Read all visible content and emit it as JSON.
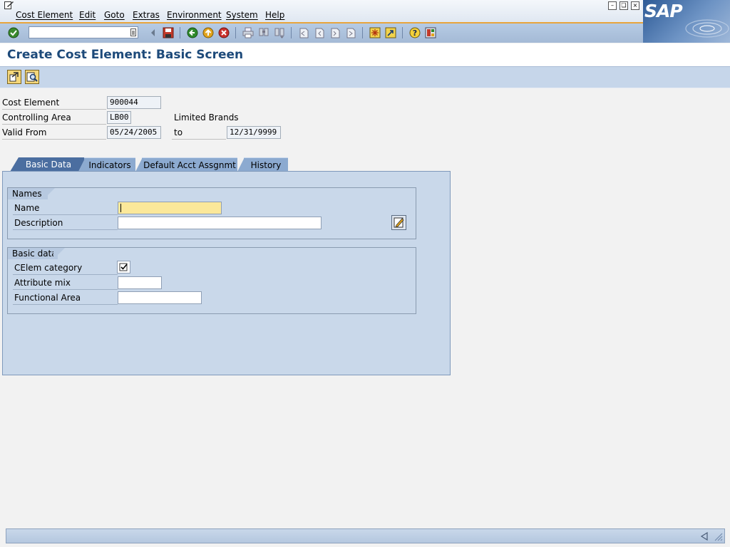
{
  "menu": {
    "items": [
      {
        "label": "Cost Element"
      },
      {
        "label": "Edit"
      },
      {
        "label": "Goto"
      },
      {
        "label": "Extras"
      },
      {
        "label": "Environment"
      },
      {
        "label": "System"
      },
      {
        "label": "Help"
      }
    ]
  },
  "logo": {
    "text": "SAP"
  },
  "toolbar": {
    "command_field_value": "",
    "icons": [
      "enter-check-icon",
      "save-icon",
      "back-icon",
      "exit-icon",
      "cancel-icon",
      "print-icon",
      "find-icon",
      "find-next-icon",
      "first-page-icon",
      "previous-page-icon",
      "next-page-icon",
      "last-page-icon",
      "create-session-icon",
      "shortcut-icon",
      "help-icon",
      "layout-icon"
    ]
  },
  "page": {
    "title": "Create Cost Element: Basic Screen"
  },
  "header": {
    "cost_element_label": "Cost Element",
    "cost_element_value": "900044",
    "controlling_area_label": "Controlling Area",
    "controlling_area_value": "LB00",
    "controlling_area_text": "Limited Brands",
    "valid_from_label": "Valid From",
    "valid_from_value": "05/24/2005",
    "to_label": "to",
    "valid_to_value": "12/31/9999"
  },
  "tabs": [
    {
      "label": "Basic Data",
      "active": true
    },
    {
      "label": "Indicators",
      "active": false
    },
    {
      "label": "Default Acct Assgnmt",
      "active": false
    },
    {
      "label": "History",
      "active": false
    }
  ],
  "names_group": {
    "title": "Names",
    "name_label": "Name",
    "name_value": "",
    "description_label": "Description",
    "description_value": ""
  },
  "basic_group": {
    "title": "Basic data",
    "celem_category_label": "CElem category",
    "attribute_mix_label": "Attribute mix",
    "attribute_mix_value": "",
    "functional_area_label": "Functional Area",
    "functional_area_value": ""
  },
  "colors": {
    "title": "#1d4a7a",
    "toolbar": "#a9bfda",
    "active_tab": "#4b6ea0",
    "inactive_tab": "#8caad0",
    "required_field": "#fbe89a"
  }
}
